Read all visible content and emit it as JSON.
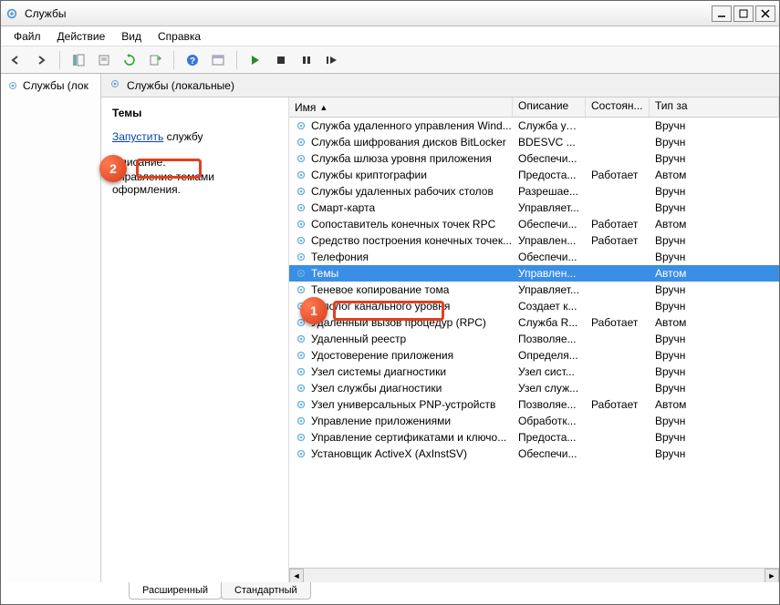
{
  "window": {
    "title": "Службы"
  },
  "menu": {
    "file": "Файл",
    "action": "Действие",
    "view": "Вид",
    "help": "Справка"
  },
  "tree": {
    "root": "Службы (лок"
  },
  "detail_header": "Службы (локальные)",
  "left": {
    "selected_service": "Темы",
    "action_link": "Запустить",
    "action_rest": " службу",
    "desc_label": "Описание:",
    "desc_text": "Управление темами оформления."
  },
  "columns": {
    "name": "Имя",
    "desc": "Описание",
    "state": "Состоян...",
    "type": "Тип за"
  },
  "services": [
    {
      "name": "Служба удаленного управления Wind...",
      "desc": "Служба уд...",
      "state": "",
      "type": "Вручн",
      "sel": false
    },
    {
      "name": "Служба шифрования дисков BitLocker",
      "desc": "BDESVC ...",
      "state": "",
      "type": "Вручн",
      "sel": false
    },
    {
      "name": "Служба шлюза уровня приложения",
      "desc": "Обеспечи...",
      "state": "",
      "type": "Вручн",
      "sel": false
    },
    {
      "name": "Службы криптографии",
      "desc": "Предоста...",
      "state": "Работает",
      "type": "Автом",
      "sel": false
    },
    {
      "name": "Службы удаленных рабочих столов",
      "desc": "Разрешае...",
      "state": "",
      "type": "Вручн",
      "sel": false
    },
    {
      "name": "Смарт-карта",
      "desc": "Управляет...",
      "state": "",
      "type": "Вручн",
      "sel": false
    },
    {
      "name": "Сопоставитель конечных точек RPC",
      "desc": "Обеспечи...",
      "state": "Работает",
      "type": "Автом",
      "sel": false
    },
    {
      "name": "Средство построения конечных точек...",
      "desc": "Управлен...",
      "state": "Работает",
      "type": "Вручн",
      "sel": false
    },
    {
      "name": "Телефония",
      "desc": "Обеспечи...",
      "state": "",
      "type": "Вручн",
      "sel": false
    },
    {
      "name": "Темы",
      "desc": "Управлен...",
      "state": "",
      "type": "Автом",
      "sel": true
    },
    {
      "name": "Теневое копирование тома",
      "desc": "Управляет...",
      "state": "",
      "type": "Вручн",
      "sel": false
    },
    {
      "name": "Тополог канального уровня",
      "desc": "Создает к...",
      "state": "",
      "type": "Вручн",
      "sel": false
    },
    {
      "name": "Удаленный вызов процедур (RPC)",
      "desc": "Служба R...",
      "state": "Работает",
      "type": "Автом",
      "sel": false
    },
    {
      "name": "Удаленный реестр",
      "desc": "Позволяе...",
      "state": "",
      "type": "Вручн",
      "sel": false
    },
    {
      "name": "Удостоверение приложения",
      "desc": "Определя...",
      "state": "",
      "type": "Вручн",
      "sel": false
    },
    {
      "name": "Узел системы диагностики",
      "desc": "Узел сист...",
      "state": "",
      "type": "Вручн",
      "sel": false
    },
    {
      "name": "Узел службы диагностики",
      "desc": "Узел служ...",
      "state": "",
      "type": "Вручн",
      "sel": false
    },
    {
      "name": "Узел универсальных PNP-устройств",
      "desc": "Позволяе...",
      "state": "Работает",
      "type": "Автом",
      "sel": false
    },
    {
      "name": "Управление приложениями",
      "desc": "Обработк...",
      "state": "",
      "type": "Вручн",
      "sel": false
    },
    {
      "name": "Управление сертификатами и ключо...",
      "desc": "Предоста...",
      "state": "",
      "type": "Вручн",
      "sel": false
    },
    {
      "name": "Установщик ActiveX (AxInstSV)",
      "desc": "Обеспечи...",
      "state": "",
      "type": "Вручн",
      "sel": false
    }
  ],
  "tabs": {
    "extended": "Расширенный",
    "standard": "Стандартный"
  },
  "callouts": {
    "one": "1",
    "two": "2"
  }
}
